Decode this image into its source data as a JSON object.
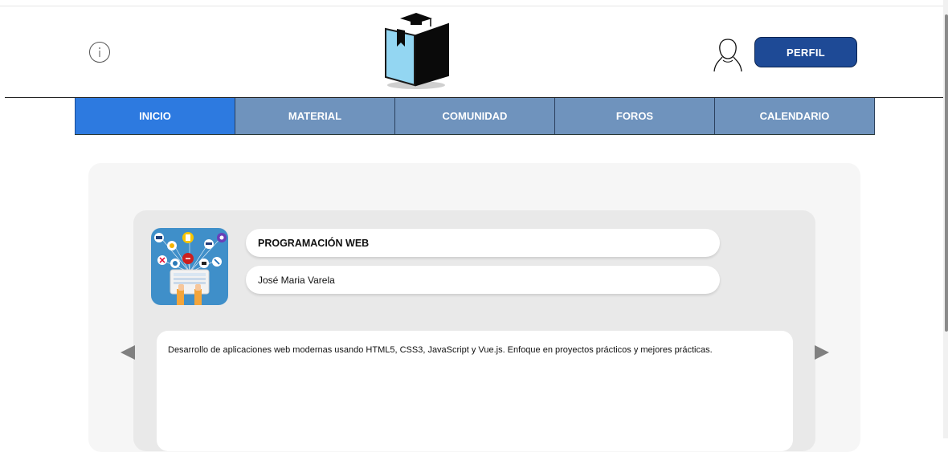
{
  "header": {
    "info_icon": "info-circle-icon",
    "logo_icon": "graduation-book-logo",
    "user_icon": "user-outline-icon",
    "profile_button": "PERFIL"
  },
  "nav": {
    "tabs": [
      {
        "label": "INICIO",
        "active": true
      },
      {
        "label": "MATERIAL",
        "active": false
      },
      {
        "label": "COMUNIDAD",
        "active": false
      },
      {
        "label": "FOROS",
        "active": false
      },
      {
        "label": "CALENDARIO",
        "active": false
      }
    ]
  },
  "course": {
    "title": "PROGRAMACIÓN WEB",
    "teacher": "José Maria Varela",
    "description": "Desarrollo de aplicaciones web modernas usando HTML5, CSS3, JavaScript y Vue.js. Enfoque en proyectos prácticos y mejores prácticas.",
    "image_icon": "web-programming-illustration"
  },
  "carousel": {
    "prev_icon": "triangle-left-icon",
    "next_icon": "triangle-right-icon"
  },
  "colors": {
    "profile_button": "#1e4a96",
    "tab_active": "#2d7ae0",
    "tab_inactive": "#6f93bd",
    "card_outer": "#f6f6f6",
    "card_inner": "#e9e9e9"
  }
}
